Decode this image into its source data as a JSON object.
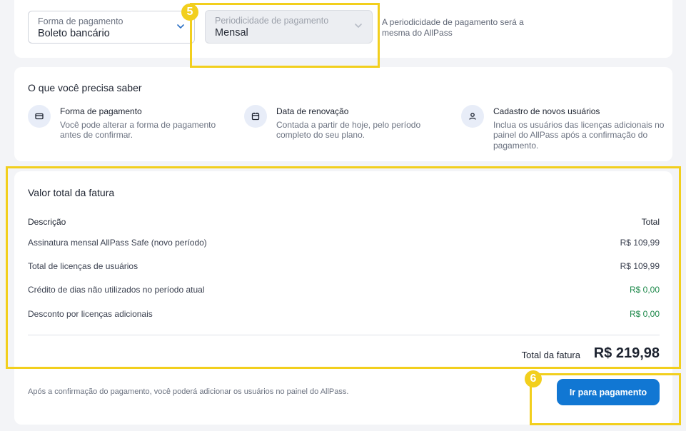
{
  "payment": {
    "forma": {
      "label": "Forma de pagamento",
      "value": "Boleto bancário",
      "icon": "chevron-down-icon"
    },
    "periodicidade": {
      "label": "Periodicidade de pagamento",
      "value": "Mensal",
      "icon": "chevron-down-icon",
      "disabled": true
    },
    "note": "A periodicidade de pagamento será a mesma do AllPass"
  },
  "info": {
    "title": "O que você precisa saber",
    "items": [
      {
        "icon": "credit-card-icon",
        "title": "Forma de pagamento",
        "desc": "Você pode alterar a forma de pagamento antes de confirmar."
      },
      {
        "icon": "calendar-icon",
        "title": "Data de renovação",
        "desc": "Contada a partir de hoje, pelo período completo do seu plano."
      },
      {
        "icon": "user-icon",
        "title": "Cadastro de novos usuários",
        "desc": "Inclua os usuários das licenças adicionais no painel do AllPass após a confirmação do pagamento."
      }
    ]
  },
  "invoice": {
    "title": "Valor total da fatura",
    "col_description": "Descrição",
    "col_total": "Total",
    "rows": [
      {
        "description": "Assinatura mensal AllPass Safe (novo período)",
        "amount": "R$ 109,99",
        "status": "normal"
      },
      {
        "description": "Total de licenças de usuários",
        "amount": "R$ 109,99",
        "status": "normal"
      },
      {
        "description": "Crédito de dias não utilizados no período atual",
        "amount": "R$ 0,00",
        "status": "credit"
      },
      {
        "description": "Desconto por licenças adicionais",
        "amount": "R$ 0,00",
        "status": "credit"
      }
    ],
    "total_label": "Total da fatura",
    "total_value": "R$ 219,98"
  },
  "footer": {
    "note": "Após a confirmação do pagamento, você poderá adicionar os usuários no painel do AllPass.",
    "pay_button": "Ir para pagamento"
  },
  "tutorial": {
    "step_a": "5",
    "step_b": "6"
  },
  "colors": {
    "accent": "#1177d3",
    "highlight": "#f2cf1d",
    "credit": "#1f8a4c",
    "background": "#f3f4f7"
  }
}
